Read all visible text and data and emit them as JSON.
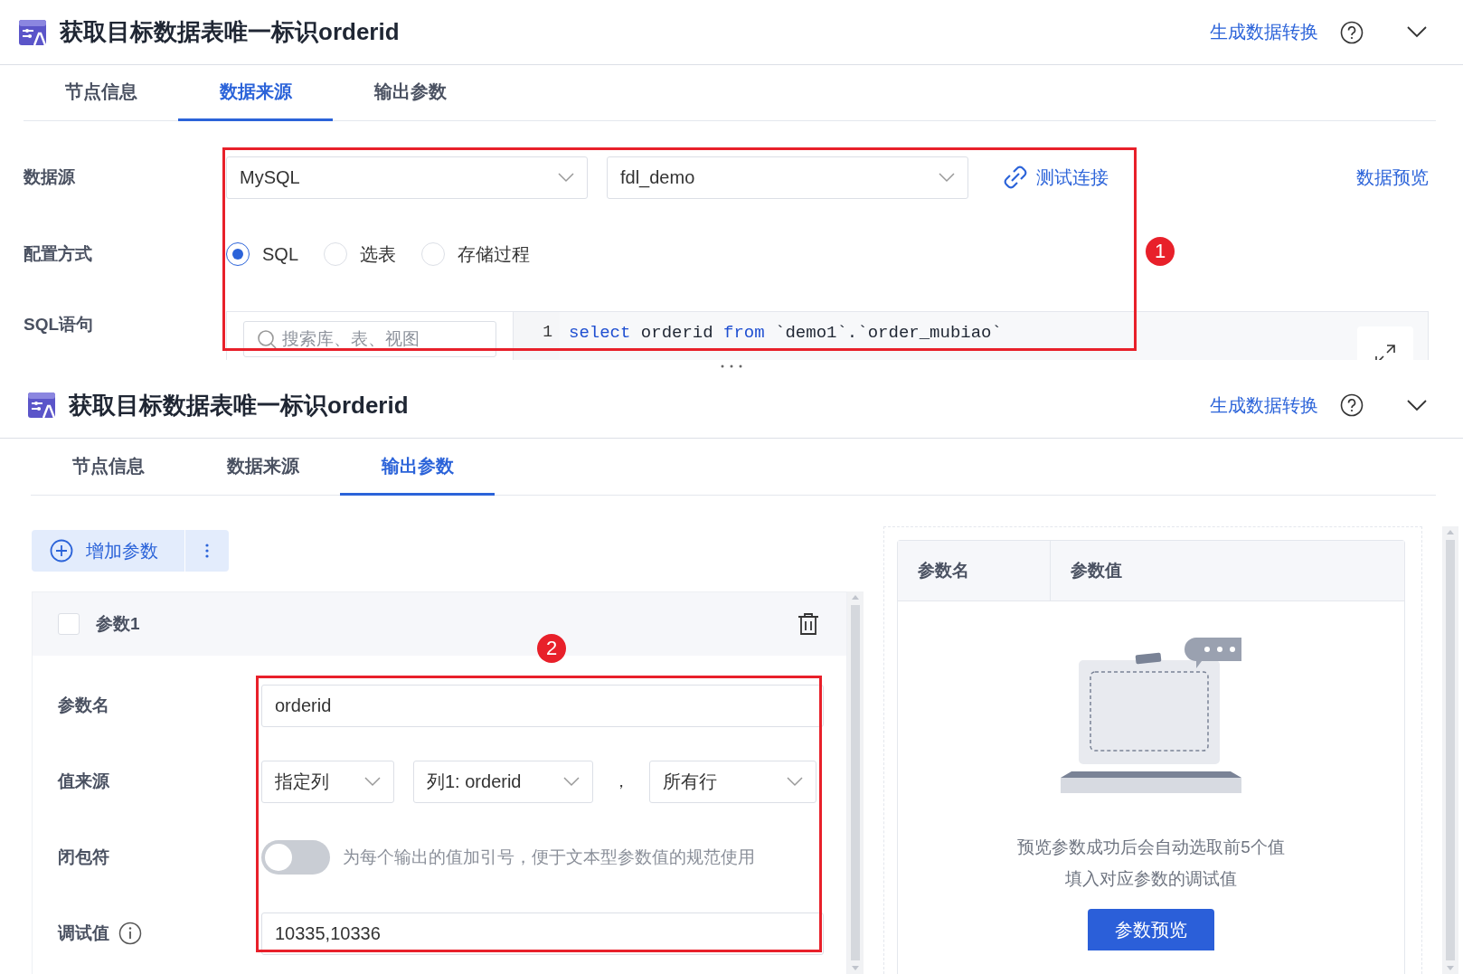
{
  "top_panel": {
    "header": {
      "title": "获取目标数据表唯一标识orderid",
      "action": "生成数据转换"
    },
    "tabs": [
      {
        "label": "节点信息",
        "selected": false
      },
      {
        "label": "数据来源",
        "selected": true
      },
      {
        "label": "输出参数",
        "selected": false
      }
    ],
    "datasource": {
      "label": "数据源",
      "selects": [
        {
          "value": "MySQL"
        },
        {
          "value": "fdl_demo"
        }
      ],
      "test_link": "测试连接",
      "preview_link": "数据预览"
    },
    "config": {
      "label": "配置方式",
      "options": [
        {
          "label": "SQL",
          "selected": true
        },
        {
          "label": "选表",
          "selected": false
        },
        {
          "label": "存储过程",
          "selected": false
        }
      ]
    },
    "sql": {
      "label": "SQL语句",
      "search_placeholder": "搜索库、表、视图",
      "line_number": "1",
      "code": [
        {
          "kind": "keyword",
          "text": "select"
        },
        {
          "kind": "plain",
          "text": " orderid "
        },
        {
          "kind": "keyword",
          "text": "from"
        },
        {
          "kind": "plain",
          "text": " `demo1`.`order_mubiao`"
        }
      ]
    },
    "annotation": "1"
  },
  "bottom_panel": {
    "header": {
      "title": "获取目标数据表唯一标识orderid",
      "action": "生成数据转换"
    },
    "tabs": [
      {
        "label": "节点信息",
        "selected": false
      },
      {
        "label": "数据来源",
        "selected": false
      },
      {
        "label": "输出参数",
        "selected": true
      }
    ],
    "add_button": "增加参数",
    "param": {
      "title": "参数1",
      "checked": false,
      "name": {
        "label": "参数名",
        "value": "orderid"
      },
      "source": {
        "label": "值来源",
        "selects": [
          {
            "value": "指定列"
          },
          {
            "value": "列1: orderid"
          }
        ],
        "separator": "，",
        "rows_select": {
          "value": "所有行"
        }
      },
      "closure": {
        "label": "闭包符",
        "on": false,
        "hint": "为每个输出的值加引号，便于文本型参数值的规范使用"
      },
      "debug": {
        "label": "调试值",
        "value": "10335,10336"
      }
    },
    "preview": {
      "columns": [
        "参数名",
        "参数值"
      ],
      "empty_lines": [
        "预览参数成功后会自动选取前5个值",
        "填入对应参数的调试值"
      ],
      "button": "参数预览"
    },
    "annotation": "2"
  }
}
